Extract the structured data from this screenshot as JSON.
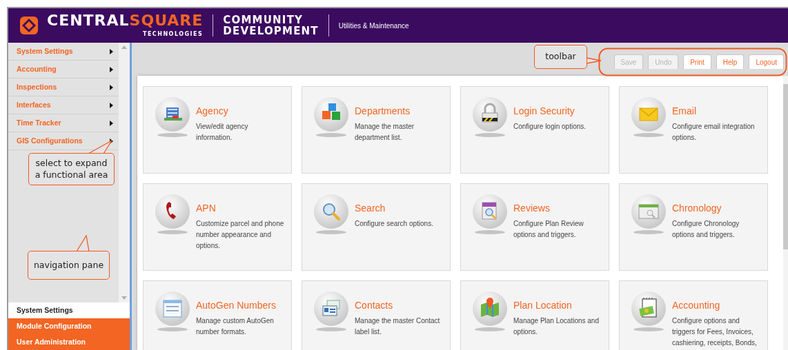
{
  "header": {
    "logo": {
      "word_1": "CENTRAL",
      "word_2": "SQUARE",
      "tagline": "TECHNOLOGIES"
    },
    "product": {
      "line_1": "COMMUNITY",
      "line_2": "DEVELOPMENT"
    },
    "module": "Utilities & Maintenance"
  },
  "sidebar": {
    "items": [
      {
        "label": "System Settings"
      },
      {
        "label": "Accounting"
      },
      {
        "label": "Inspections"
      },
      {
        "label": "Interfaces"
      },
      {
        "label": "Time Tracker"
      },
      {
        "label": "GIS Configurations"
      }
    ],
    "bottom_tabs": [
      {
        "label": "System Settings",
        "selected": true
      },
      {
        "label": "Module Configuration",
        "selected": false
      },
      {
        "label": "User Administration",
        "selected": false
      }
    ]
  },
  "toolbar": {
    "buttons": [
      {
        "label": "Save",
        "disabled": true
      },
      {
        "label": "Undo",
        "disabled": true
      },
      {
        "label": "Print",
        "disabled": false
      },
      {
        "label": "Help",
        "disabled": false
      },
      {
        "label": "Logout",
        "disabled": false
      }
    ]
  },
  "tiles": [
    {
      "title": "Agency",
      "description": "View/edit agency information."
    },
    {
      "title": "Departments",
      "description": "Manage the master department list."
    },
    {
      "title": "Login Security",
      "description": "Configure login options."
    },
    {
      "title": "Email",
      "description": "Configure email integration options."
    },
    {
      "title": "APN",
      "description": "Customize parcel and phone number appearance and options."
    },
    {
      "title": "Search",
      "description": "Configure search options."
    },
    {
      "title": "Reviews",
      "description": "Configure Plan Review options and triggers."
    },
    {
      "title": "Chronology",
      "description": "Configure Chronology options and triggers."
    },
    {
      "title": "AutoGen Numbers",
      "description": "Manage custom AutoGen number formats."
    },
    {
      "title": "Contacts",
      "description": "Manage the master Contact label list."
    },
    {
      "title": "Plan Location",
      "description": "Manage Plan Locations and options."
    },
    {
      "title": "Accounting",
      "description": "Configure options and triggers for Fees, Invoices, cashiering, receipts, Bonds,"
    }
  ],
  "annotations": [
    {
      "text": "toolbar"
    },
    {
      "text": "select to expand a functional area"
    },
    {
      "text": "navigation pane"
    }
  ]
}
